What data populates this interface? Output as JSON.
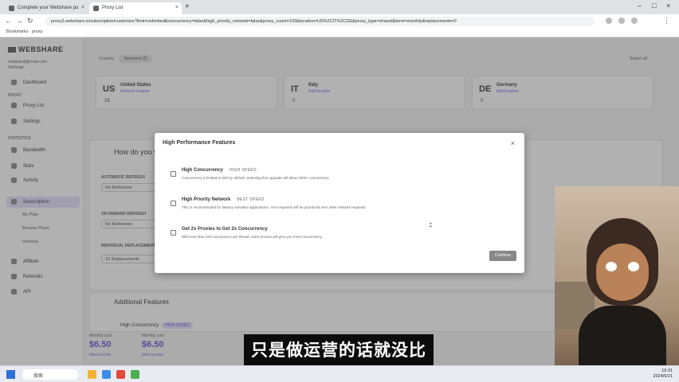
{
  "browser": {
    "tabs": [
      {
        "label": "Complete your Webshare pu",
        "active": false
      },
      {
        "label": "Proxy List",
        "active": true
      }
    ],
    "url": "proxy2.webshare.io/subscription/customize?limit=unlimited&concurrency=false&high_priority_network=false&proxy_count=100&location=US%2CIT%2CDE&proxy_type=shared&term=monthly&replacements=0",
    "bookmarks": [
      "Bookmarks",
      "proxy"
    ]
  },
  "sidebar": {
    "brand": "WEBSHARE",
    "account_line1": "redacted@mail.com",
    "account_line2": "Settings",
    "items": [
      {
        "label": "Dashboard"
      },
      {
        "section": "PROXY"
      },
      {
        "label": "Proxy List"
      },
      {
        "label": "Settings"
      },
      {
        "section": "STATISTICS"
      },
      {
        "label": "Bandwidth"
      },
      {
        "label": "Stats"
      },
      {
        "label": "Activity"
      },
      {
        "label": "Subscription"
      },
      {
        "label": "My Plan"
      },
      {
        "label": "Browse Plans"
      },
      {
        "label": "Invoices"
      },
      {
        "label": "Affiliate"
      },
      {
        "label": "Referrals"
      },
      {
        "label": "API"
      }
    ]
  },
  "main": {
    "filter_label": "Country",
    "filter_chip": "Selected (3)",
    "topright": "Select all",
    "countries": [
      {
        "code": "US",
        "name": "United States",
        "sub": "Remove location",
        "count": "28"
      },
      {
        "code": "IT",
        "name": "Italy",
        "sub": "Add location",
        "count": "0"
      },
      {
        "code": "DE",
        "name": "Germany",
        "sub": "Add location",
        "count": "0"
      }
    ],
    "how_title": "How do you w",
    "options": [
      {
        "label": "AUTOMATIC REFRESH",
        "value": "No Refreshes"
      },
      {
        "label": "ON DEMAND REFRESH",
        "value": "No Refreshes"
      },
      {
        "label": "INDIVIDUAL REPLACEMENT",
        "value": "10 Replacements"
      }
    ],
    "additional_title": "Additional Features",
    "additional_item": "High Concurrency",
    "additional_chip": "HIGH SPEED",
    "prices": [
      {
        "label": "Monthly cost",
        "value": "$6.50",
        "sub": "billed monthly"
      },
      {
        "label": "Monthly cost",
        "value": "$6.50",
        "sub": "billed monthly"
      }
    ]
  },
  "modal": {
    "title": "High Performance Features",
    "close": "×",
    "features": [
      {
        "title": "High Concurrency",
        "tag": "HIGH SPEED",
        "desc": "Concurrency is limited to 500 by default. Selecting this upgrade will allow 2000+ concurrency."
      },
      {
        "title": "High Priority Network",
        "tag": "BEST SPEED",
        "desc": "This is recommended for latency sensitive applications. Your requests will be prioritized over other network requests."
      },
      {
        "title": "Get 2x Proxies to Get 2x Concurrency",
        "tag": "",
        "desc": "With less than 100 concurrency per thread, more proxies will give you more concurrency."
      }
    ],
    "button": "Continue"
  },
  "subtitle": "只是做运营的话就没比较",
  "taskbar": {
    "search": "搜索",
    "time": "16:31",
    "date": "2024/5/21"
  }
}
